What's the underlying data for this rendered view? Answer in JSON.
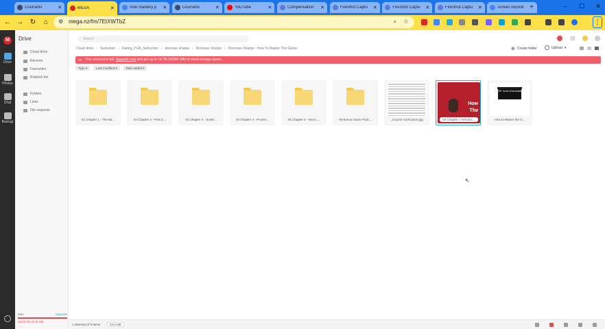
{
  "browser": {
    "tabs": [
      {
        "label": "Coursefix",
        "color": "#3b4a6b"
      },
      {
        "label": "MEGA",
        "color": "#d9272e"
      },
      {
        "label": "how mastery p",
        "color": "#4285f4"
      },
      {
        "label": "Coursefix",
        "color": "#3b4a6b"
      },
      {
        "label": "YouTube",
        "color": "#ff0000"
      },
      {
        "label": "Compensation",
        "color": "#5a7bd8"
      },
      {
        "label": "FireShot Captu",
        "color": "#5a7bd8"
      },
      {
        "label": "FireShot Captu",
        "color": "#5a7bd8"
      },
      {
        "label": "FireShot Captu",
        "color": "#5a7bd8"
      },
      {
        "label": "screen recordi",
        "color": "#4285f4"
      }
    ],
    "active_tab_index": 1,
    "url": "mega.nz/fm/7EtXWTbZ"
  },
  "rail": {
    "items": [
      {
        "label": "Drive",
        "color": "#4fa6e0"
      },
      {
        "label": "Photos",
        "color": "#bbbbbb"
      },
      {
        "label": "Chat",
        "color": "#bbbbbb"
      },
      {
        "label": "Backup",
        "color": "#bbbbbb"
      }
    ]
  },
  "sidebar": {
    "title": "Drive",
    "items": [
      "Cloud drive",
      "Recents",
      "Favourites",
      "Rubbish bin",
      "Folders",
      "Links",
      "File requests"
    ],
    "storage_label": "Max",
    "storage_link": "Upgrade",
    "storage_text": "23.04 TB of 20 GB"
  },
  "main": {
    "search_placeholder": "Search",
    "breadcrumbs": [
      "Cloud drive",
      "Seduction",
      "Dating_PUA_Seduction",
      "donovan sharpe",
      "Donovan Sharpe",
      "Donovan Sharpe - How To Master The Game"
    ],
    "new_folder": "Create folder",
    "upload": "Upload",
    "banner": {
      "text": "Your account is full.",
      "link": "Upgrade now",
      "rest": "and get up to 16 TB (16384 GB) of cloud storage space."
    },
    "filters": [
      "Type",
      "Last modified",
      "Date added"
    ],
    "files": [
      {
        "name": "01 Chapter 1 - The Ba...",
        "kind": "folder"
      },
      {
        "name": "02 Chapter 2 - First d...",
        "kind": "folder"
      },
      {
        "name": "03 Chapter 3 - Under...",
        "kind": "folder"
      },
      {
        "name": "04 Chapter 4 - Proven...",
        "kind": "folder"
      },
      {
        "name": "05 Chapter 5 - Next L...",
        "kind": "folder"
      },
      {
        "name": "06 Bonus Game Podc...",
        "kind": "folder"
      },
      {
        "name": "_Course Curriculum.jpg",
        "kind": "doc"
      },
      {
        "name": "00 Chapter 1 Introduc...",
        "kind": "video",
        "overlay": "How",
        "overlay2": "The"
      },
      {
        "name": "How to Master the G...",
        "kind": "image",
        "headline": "25+ hours of knowledge"
      }
    ],
    "status": {
      "selection": "1 selected of 9 items",
      "size": "52.6 MB"
    }
  }
}
